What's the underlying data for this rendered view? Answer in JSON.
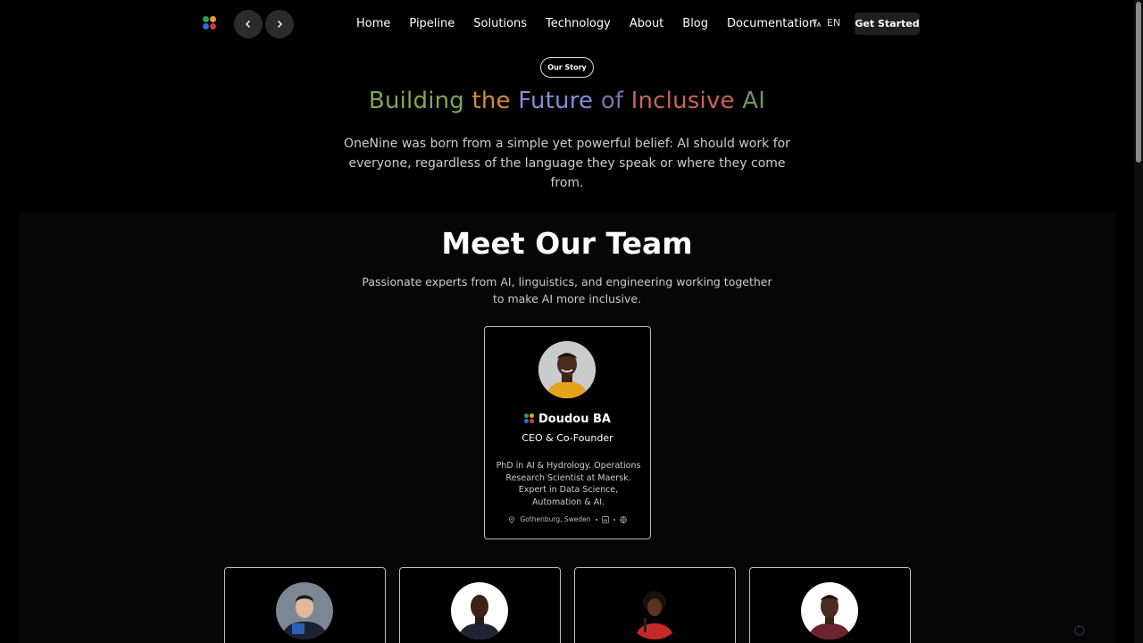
{
  "nav": {
    "logo_icon": "onenine-logo-icon",
    "back_icon": "chevron-left-icon",
    "forward_icon": "chevron-right-icon",
    "items": [
      "Home",
      "Pipeline",
      "Solutions",
      "Technology",
      "About",
      "Blog",
      "Documentation"
    ],
    "language": "EN",
    "language_icon": "translate-icon",
    "cta": "Get Started"
  },
  "hero": {
    "pill": "Our Story",
    "title_words": [
      "Building",
      "the",
      "Future",
      "of",
      "Inclusive",
      "AI"
    ],
    "subtitle": "OneNine was born from a simple yet powerful belief: AI should work for everyone, regardless of the language they speak or where they come from."
  },
  "team": {
    "title": "Meet Our Team",
    "subtitle": "Passionate experts from AI, linguistics, and engineering working together to make AI more inclusive.",
    "lead": {
      "name": "Doudou BA",
      "role": "CEO & Co-Founder",
      "bio": "PhD in AI & Hydrology. Operations Research Scientist at Maersk. Expert in Data Science, Automation & AI.",
      "location": "Gothenburg, Sweden",
      "location_icon": "map-pin-icon",
      "linkedin_icon": "linkedin-icon",
      "web_icon": "globe-icon"
    },
    "members": [
      {
        "avatar": "member-photo-1"
      },
      {
        "avatar": "member-photo-2"
      },
      {
        "avatar": "member-photo-3"
      },
      {
        "avatar": "member-photo-4"
      }
    ]
  },
  "colors": {
    "background": "#000000",
    "button": "#1f1f1f",
    "logo": [
      "#3a9a48",
      "#e0a225",
      "#2f6fd1",
      "#d43a34"
    ]
  }
}
